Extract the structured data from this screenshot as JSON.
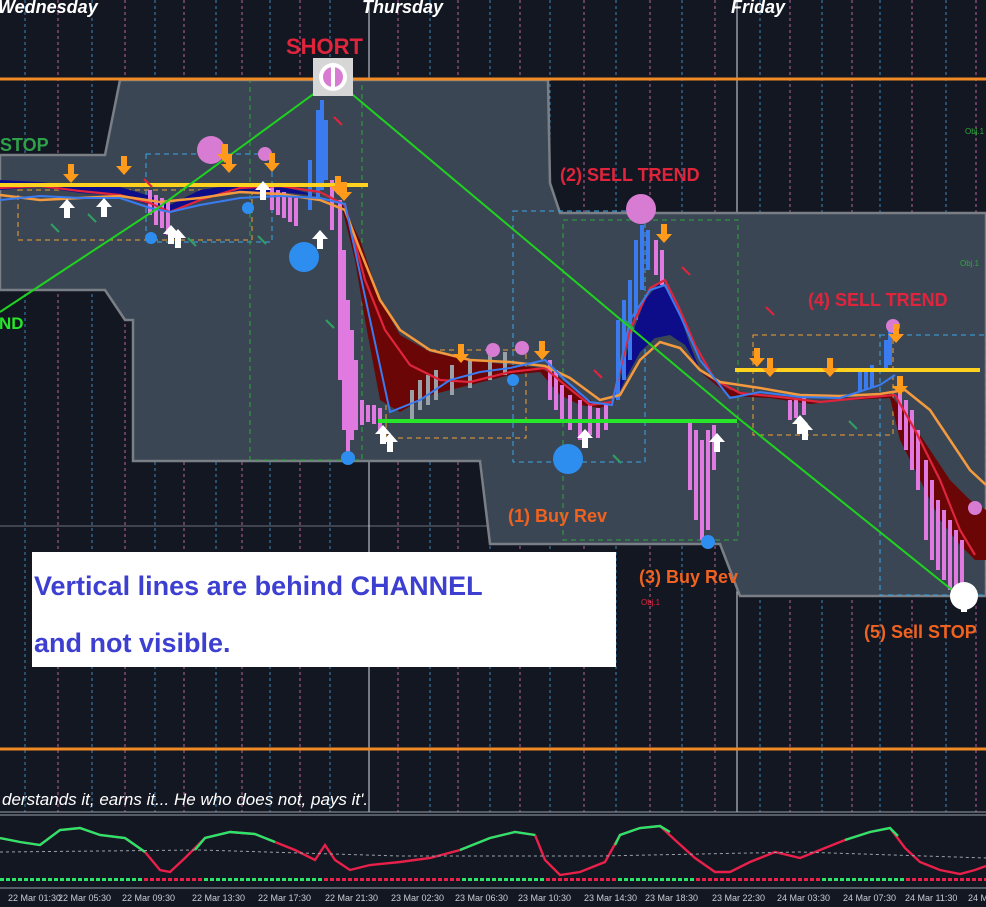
{
  "colors": {
    "background": "#131722",
    "channel": "#3b4655",
    "channel_border": "#7a7f86",
    "level_line": "#f08a24",
    "resistance": "#ffd21f",
    "support": "#27e62a",
    "trend_line": "#1fd21f",
    "sell_label": "#e0243c",
    "buy_label": "#f0621f",
    "note_text": "#3d3fd0",
    "signal_arrow_down": "#ff9a1a",
    "signal_arrow_up": "#ffffff",
    "bull_fill": "#0d0d8a",
    "bear_fill": "#6a0606"
  },
  "day_labels": [
    "Wednesday",
    "Thursday",
    "Friday"
  ],
  "signals": {
    "short": "SHORT",
    "sell_trend_2": "(2) SELL TREND",
    "sell_trend_4": "(4) SELL TREND",
    "buy_rev_1": "(1) Buy Rev",
    "buy_rev_3": "(3) Buy Rev",
    "sell_stop_5": "(5) Sell STOP",
    "stop_left": "STOP",
    "nd_left": "ND"
  },
  "objects": {
    "obj1_a": "Obj.1",
    "obj1_b": "Obj.1",
    "obj1_c": "Obj.1"
  },
  "note": {
    "line1": "Vertical lines are behind CHANNEL",
    "line2": "and not visible."
  },
  "quote": "derstands it, earns it... He who does not, pays it'.",
  "time_axis": [
    "22 Mar 01:30",
    "22 Mar 05:30",
    "22 Mar 09:30",
    "22 Mar 13:30",
    "22 Mar 17:30",
    "22 Mar 21:30",
    "23 Mar 02:30",
    "23 Mar 06:30",
    "23 Mar 10:30",
    "23 Mar 14:30",
    "23 Mar 18:30",
    "23 Mar 22:30",
    "24 Mar 03:30",
    "24 Mar 07:30",
    "24 Mar 11:30",
    "24 M"
  ]
}
